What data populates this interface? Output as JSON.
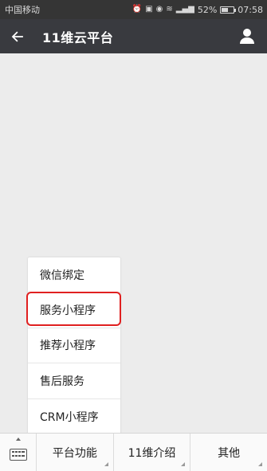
{
  "status_bar": {
    "carrier": "中国移动",
    "battery_percent": "52%",
    "battery_level": 0.52,
    "time": "07:58"
  },
  "nav": {
    "title": "11维云平台",
    "back_icon": "back-arrow-icon",
    "profile_icon": "person-icon"
  },
  "popup": {
    "items": [
      {
        "label": "微信绑定"
      },
      {
        "label": "服务小程序"
      },
      {
        "label": "推荐小程序"
      },
      {
        "label": "售后服务"
      },
      {
        "label": "CRM小程序"
      }
    ],
    "highlight_color": "#e02020"
  },
  "bottom_menu": {
    "keyboard_icon": "keyboard-icon",
    "buttons": [
      {
        "label": "平台功能"
      },
      {
        "label": "11维介绍"
      },
      {
        "label": "其他"
      }
    ]
  }
}
